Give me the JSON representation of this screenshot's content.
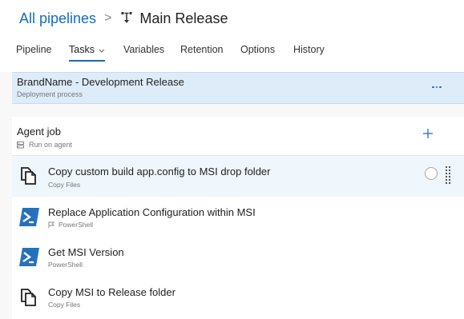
{
  "breadcrumb": {
    "parent": "All pipelines",
    "separator": ">",
    "current": "Main Release",
    "icon": "release-pipeline-icon"
  },
  "tabs": [
    {
      "label": "Pipeline",
      "active": false
    },
    {
      "label": "Tasks",
      "active": true,
      "has_dropdown": true
    },
    {
      "label": "Variables",
      "active": false
    },
    {
      "label": "Retention",
      "active": false
    },
    {
      "label": "Options",
      "active": false
    },
    {
      "label": "History",
      "active": false
    }
  ],
  "process": {
    "title": "BrandName - Development Release",
    "subtitle": "Deployment process",
    "more_icon": "ellipsis-icon"
  },
  "agent_job": {
    "title": "Agent job",
    "subtitle": "Run on agent",
    "add_icon": "plus-icon"
  },
  "tasks": [
    {
      "title": "Copy custom build app.config to MSI drop folder",
      "subtitle": "Copy Files",
      "icon": "copy-files-icon",
      "selected": true,
      "flag": false
    },
    {
      "title": "Replace Application Configuration within MSI",
      "subtitle": "PowerShell",
      "icon": "powershell-icon",
      "selected": false,
      "flag": true
    },
    {
      "title": "Get MSI Version",
      "subtitle": "PowerShell",
      "icon": "powershell-icon",
      "selected": false,
      "flag": false
    },
    {
      "title": "Copy MSI to Release folder",
      "subtitle": "Copy Files",
      "icon": "copy-files-icon",
      "selected": false,
      "flag": false
    }
  ],
  "colors": {
    "accent": "#106ebe",
    "selected_row": "#eff6fc",
    "process_bar": "#deecf9",
    "powershell_blue": "#2671be"
  }
}
